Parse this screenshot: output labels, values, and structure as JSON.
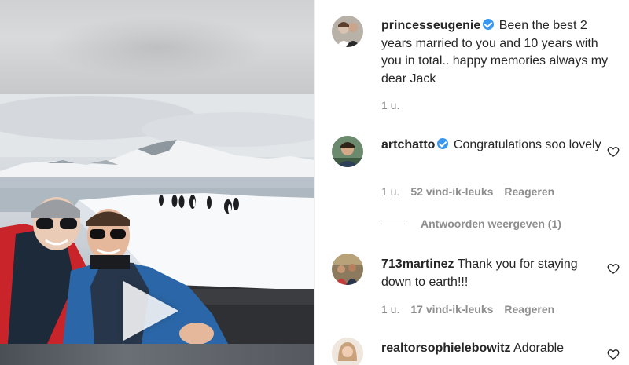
{
  "post": {
    "caption": {
      "username": "princesseugenie",
      "verified": true,
      "text": "Been the best 2 years married to you and 10 years with you in total.. happy memories always my dear Jack",
      "time": "1 u."
    }
  },
  "comments": [
    {
      "username": "artchatto",
      "verified": true,
      "text": "Congratulations soo lovely",
      "time": "1 u.",
      "likes": "52 vind-ik-leuks",
      "reply": "Reageren",
      "view_replies": "Antwoorden weergeven (1)"
    },
    {
      "username": "713martinez",
      "verified": false,
      "text": "Thank you for staying down to earth!!!",
      "time": "1 u.",
      "likes": "17 vind-ik-leuks",
      "reply": "Reageren"
    },
    {
      "username": "realtorsophielebowitz",
      "verified": false,
      "text": "Adorable",
      "time": ""
    }
  ],
  "icons": {
    "play": "play-icon",
    "verified": "verified-badge-icon",
    "like": "heart-outline-icon"
  },
  "colors": {
    "verified": "#3897f0",
    "meta": "#8e8e8e",
    "text": "#262626"
  }
}
